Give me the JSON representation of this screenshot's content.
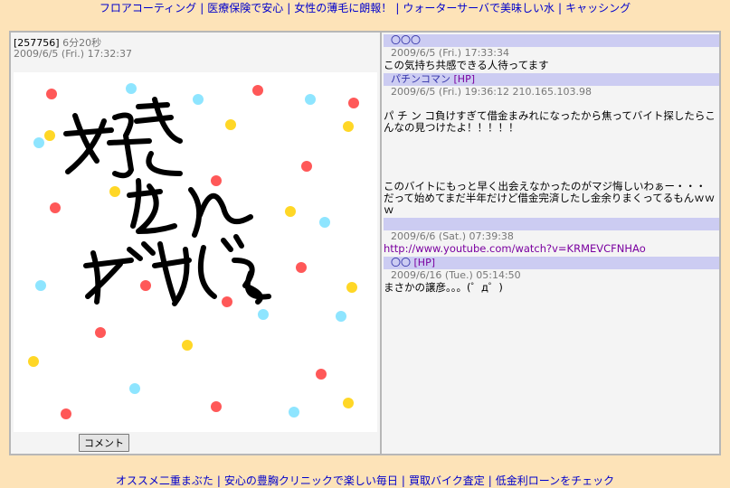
{
  "top_ads": [
    "フロアコーティング",
    "医療保険で安心",
    "女性の薄毛に朗報！",
    "ウォーターサーバで美味しい水",
    "キャッシング"
  ],
  "bottom_ads": [
    "オススメ二重まぶた",
    "安心の豊胸クリニックで楽しい毎日",
    "買取バイク査定",
    "低金利ローンをチェック"
  ],
  "post": {
    "id": "[257756]",
    "elapsed": "6分20秒",
    "date": "2009/6/5 (Fri.) 17:32:37",
    "drawing_text": [
      "好き",
      "なん",
      "だけどぉ"
    ]
  },
  "comment_button_label": "コメント",
  "comments": [
    {
      "name": "〇〇〇",
      "hp": "",
      "date": "2009/6/5 (Fri.) 17:33:34",
      "body": "この気持ち共感できる人待ってます"
    },
    {
      "name": "パチンコマン",
      "hp": "[HP]",
      "date": "2009/6/5 (Fri.) 19:36:12  210.165.103.98",
      "body": "\nパ チ ン コ負けすぎて借金まみれになったから焦ってバイト探したらこんなの見つけたよ！！！！！\n\n\n\n\nこのバイトにもっと早く出会えなかったのがマジ悔しいわぁー・・・\nだって始めてまだ半年だけど借金完済したし金余りまくってるもんｗｗｗ"
    },
    {
      "name": "",
      "hp": "",
      "date": "2009/6/6 (Sat.) 07:39:38",
      "body": "",
      "link": "http://www.youtube.com/watch?v=KRMEVCFNHAo"
    },
    {
      "name": "〇〇",
      "hp": "[HP]",
      "date": "2009/6/16 (Tue.) 05:14:50",
      "body": "まさかの譲彦。。。(゜д゜)"
    }
  ],
  "colors": {
    "background": "#fde3b8",
    "header_bar": "#ccccf2",
    "link": "#0000cc"
  }
}
